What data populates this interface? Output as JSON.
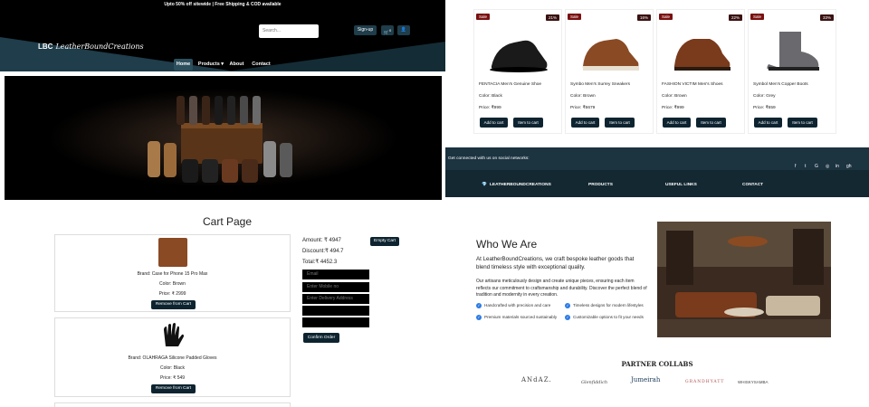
{
  "topbar": {
    "promo": "Upto 50% off sitewide | Free Shipping & COD available"
  },
  "header": {
    "logo_mark": "LBC",
    "logo_text": "LeatherBoundCreations",
    "search_placeholder": "Search...",
    "signup_label": "Sign-up",
    "cart_count": "0",
    "nav": [
      {
        "label": "Home"
      },
      {
        "label": "Products ▾"
      },
      {
        "label": "About"
      },
      {
        "label": "Contact"
      }
    ]
  },
  "products": [
    {
      "sale": "Sale",
      "discount": "21%",
      "name": "FENTACIA Men's Genuine Shoe",
      "color": "Color: Black",
      "price": "Price: ₹999",
      "add": "Add to cart",
      "item": "Item to cart",
      "shoe": "#1a1a1a"
    },
    {
      "sale": "Sale",
      "discount": "16%",
      "name": "Symbo Men's Surrey Sneakers",
      "color": "Color: Brown",
      "price": "Price: ₹6679",
      "add": "Add to cart",
      "item": "Item to cart",
      "shoe": "#8a4a24"
    },
    {
      "sale": "Sale",
      "discount": "22%",
      "name": "FASHION VICTIM Men's Shoes",
      "color": "Color: Brown",
      "price": "Price: ₹999",
      "add": "Add to cart",
      "item": "Item to cart",
      "shoe": "#7a3a1c"
    },
    {
      "sale": "Sale",
      "discount": "33%",
      "name": "Symbol Men's Copper Boots",
      "color": "Color: Grey",
      "price": "Price: ₹659",
      "add": "Add to cart",
      "item": "Item to cart",
      "shoe": "#6a6a6e"
    }
  ],
  "footer": {
    "social_text": "Get connected with us on social networks:",
    "social_icons": [
      "f",
      "t",
      "G",
      "◎",
      "in",
      "gh"
    ],
    "columns": [
      "LEATHERBOUNDCREATIONS",
      "PRODUCTS",
      "USEFUL LINKS",
      "CONTACT"
    ]
  },
  "cart": {
    "title": "Cart Page",
    "items": [
      {
        "brand": "Brand: Case for Phone 15 Pro Max",
        "color": "Color: Brown",
        "price": "Price: ₹ 2999",
        "remove": "Remove from Cart"
      },
      {
        "brand": "Brand: OLAHRAGA Silicone Padded Gloves",
        "color": "Color: Black",
        "price": "Price: ₹ 549",
        "remove": "Remove from Cart"
      }
    ],
    "amount": "Amount: ₹ 4947",
    "discount": "Discount:₹ 494.7",
    "total": "Total:₹ 4452.3",
    "empty_label": "Empty Cart",
    "fields": [
      "Email",
      "Enter Mobile no",
      "Enter Delivery Address",
      "",
      ""
    ],
    "confirm_label": "Confirm Order"
  },
  "about": {
    "title": "Who We Are",
    "lead": "At LeatherBoundCreations, we craft bespoke leather goods that blend timeless style with exceptional quality.",
    "body": "Our artisans meticulously design and create unique pieces, ensuring each item reflects our commitment to craftsmanship and durability. Discover the perfect blend of tradition and modernity in every creation.",
    "features": [
      "Handcrafted with precision and care",
      "Timeless designs for modern lifestyles",
      "Premium materials sourced sustainably",
      "Customizable options to fit your needs"
    ],
    "partner_title": "PARTNER COLLABS",
    "partners": [
      "ANdAZ.",
      "Glenfiddich",
      "Jumeirah",
      "GRANDHYATT",
      "WHISKYSAMBA"
    ]
  }
}
